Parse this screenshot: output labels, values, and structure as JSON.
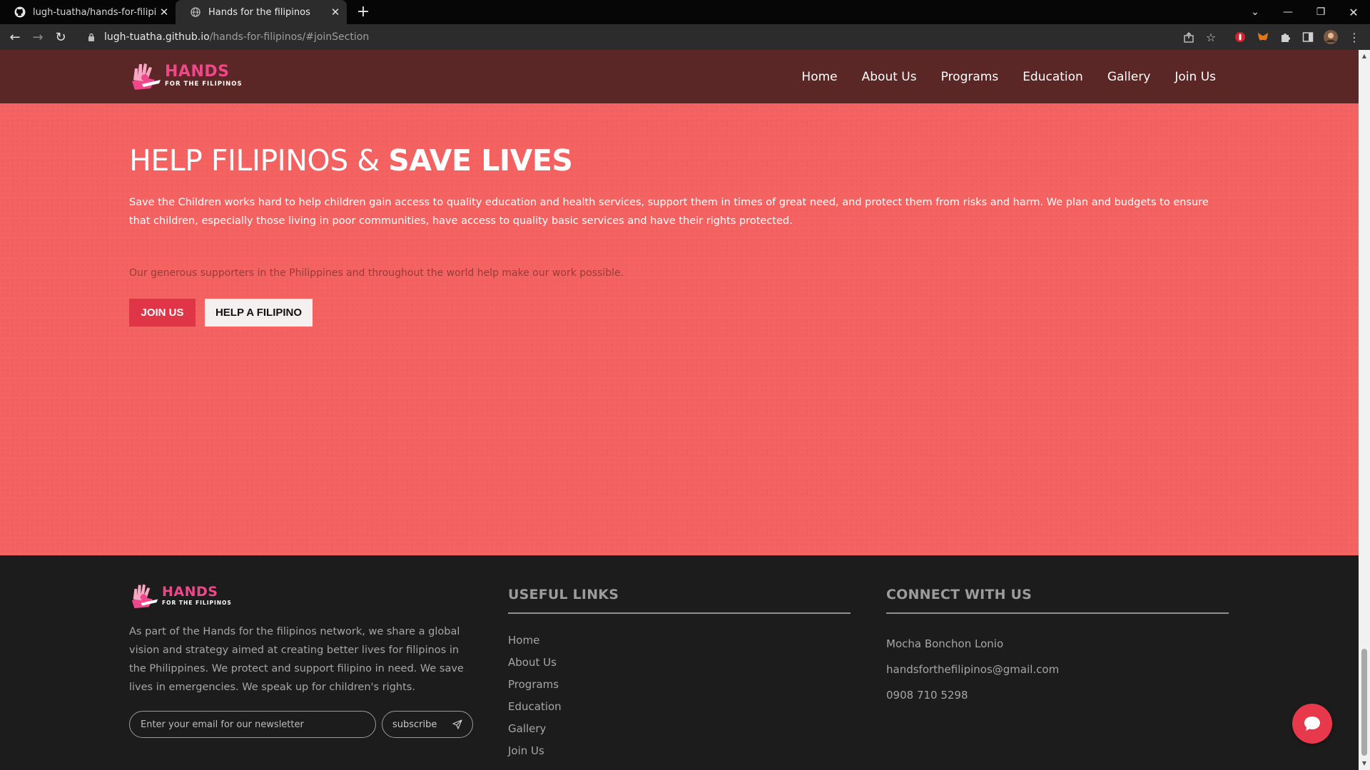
{
  "browser": {
    "tabs": [
      {
        "title": "lugh-tuatha/hands-for-filipinos",
        "icon": "github-icon",
        "active": false
      },
      {
        "title": "Hands for the filipinos",
        "icon": "globe-icon",
        "active": true
      }
    ],
    "new_tab": "+",
    "url_host": "lugh-tuatha.github.io",
    "url_path": "/hands-for-filipinos/#joinSection"
  },
  "site": {
    "logo": {
      "big": "HANDS",
      "small": "FOR THE FILIPINOS"
    },
    "nav": [
      "Home",
      "About Us",
      "Programs",
      "Education",
      "Gallery",
      "Join Us"
    ]
  },
  "hero": {
    "title_light": "HELP FILIPINOS & ",
    "title_bold": "SAVE LIVES",
    "paragraph": "Save the Children works hard to help children gain access to quality education and health services, support them in times of great need, and protect them from risks and harm. We plan and budgets to ensure that children, especially those living in poor communities, have access to quality basic services and have their rights protected.",
    "subtext": "Our generous supporters in the Philippines and throughout the world help make our work possible.",
    "btn_join": "JOIN US",
    "btn_help": "HELP A FILIPINO"
  },
  "footer": {
    "about": "As part of the Hands for the filipinos network, we share a global vision and strategy aimed at creating better lives for filipinos in the Philippines. We protect and support filipino in need. We save lives in emergencies. We speak up for children's rights.",
    "newsletter_placeholder": "Enter your email for our newsletter",
    "subscribe": "subscribe",
    "links_heading": "USEFUL LINKS",
    "links": [
      "Home",
      "About Us",
      "Programs",
      "Education",
      "Gallery",
      "Join Us"
    ],
    "connect_heading": "CONNECT WITH US",
    "contact": [
      "Mocha Bonchon Lonio",
      "handsforthefilipinos@gmail.com",
      "0908 710 5298"
    ]
  },
  "colors": {
    "nav_bg": "#5b2626",
    "hero_bg": "#f46361",
    "accent": "#e03447",
    "logo_pink": "#f0478a",
    "footer_bg": "#1c1c1c"
  }
}
